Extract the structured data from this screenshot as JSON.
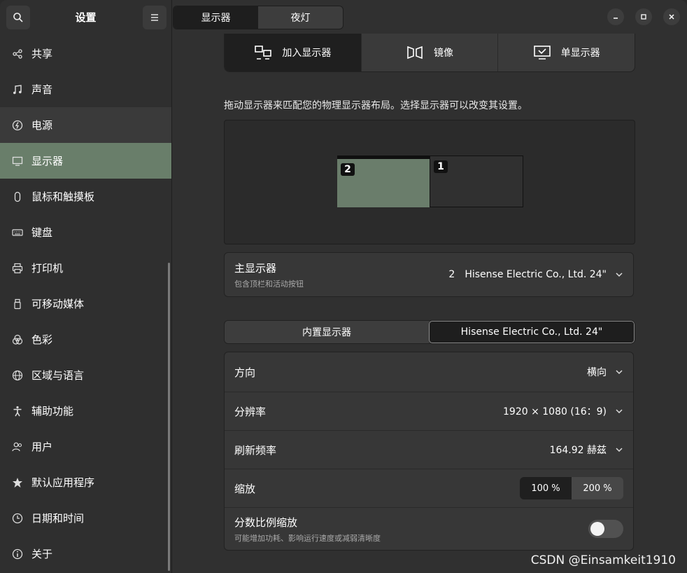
{
  "sidebar": {
    "title": "设置",
    "items": [
      {
        "label": "共享",
        "icon": "share-icon"
      },
      {
        "label": "声音",
        "icon": "music-note-icon"
      },
      {
        "label": "电源",
        "icon": "power-icon"
      },
      {
        "label": "显示器",
        "icon": "display-icon"
      },
      {
        "label": "鼠标和触摸板",
        "icon": "mouse-icon"
      },
      {
        "label": "键盘",
        "icon": "keyboard-icon"
      },
      {
        "label": "打印机",
        "icon": "printer-icon"
      },
      {
        "label": "可移动媒体",
        "icon": "usb-drive-icon"
      },
      {
        "label": "色彩",
        "icon": "color-icon"
      },
      {
        "label": "区域与语言",
        "icon": "globe-icon"
      },
      {
        "label": "辅助功能",
        "icon": "accessibility-icon"
      },
      {
        "label": "用户",
        "icon": "users-icon"
      },
      {
        "label": "默认应用程序",
        "icon": "star-icon"
      },
      {
        "label": "日期和时间",
        "icon": "clock-icon"
      },
      {
        "label": "关于",
        "icon": "info-icon"
      }
    ]
  },
  "header": {
    "tabs": [
      "显示器",
      "夜灯"
    ]
  },
  "mode_tabs": [
    "加入显示器",
    "镜像",
    "单显示器"
  ],
  "description": "拖动显示器来匹配您的物理显示器布局。选择显示器可以改变其设置。",
  "arrangement": {
    "monitors": [
      {
        "number": "2",
        "selected": true
      },
      {
        "number": "1",
        "selected": false
      }
    ]
  },
  "primary": {
    "title": "主显示器",
    "subtitle": "包含顶栏和活动按钮",
    "value_num": "2",
    "value_name": "Hisense Electric Co., Ltd. 24\""
  },
  "display_tabs": [
    "内置显示器",
    "Hisense Electric Co., Ltd. 24\""
  ],
  "settings": {
    "orientation": {
      "label": "方向",
      "value": "横向"
    },
    "resolution": {
      "label": "分辨率",
      "value": "1920 × 1080 (16：9)"
    },
    "refresh": {
      "label": "刷新频率",
      "value": "164.92 赫兹"
    },
    "scale": {
      "label": "缩放",
      "options": [
        "100 %",
        "200 %"
      ]
    },
    "fractional": {
      "label": "分数比例缩放",
      "subtitle": "可能增加功耗、影响运行速度或减弱清晰度",
      "enabled": false
    }
  },
  "watermark": "CSDN @Einsamkeit1910",
  "colors": {
    "accent": "#697e6a",
    "background": "#303030"
  }
}
